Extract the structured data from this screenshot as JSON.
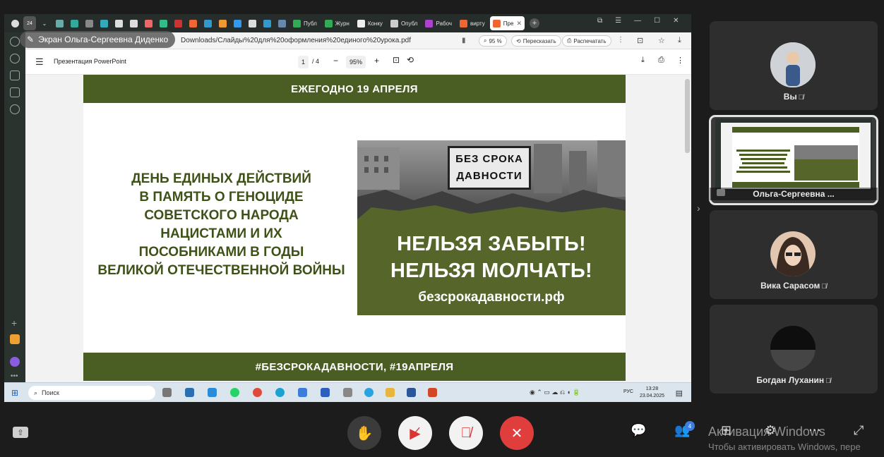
{
  "presenter_label": "Экран Ольга-Сергеевна Диденко",
  "browser": {
    "tabs": [
      {
        "label": "",
        "color": "#6aa"
      },
      {
        "label": "",
        "color": "#3a9"
      },
      {
        "label": "",
        "color": "#888"
      },
      {
        "label": "",
        "color": "#3ab"
      },
      {
        "label": "",
        "color": "#ddd"
      },
      {
        "label": "",
        "color": "#ddd"
      },
      {
        "label": "",
        "color": "#e66"
      },
      {
        "label": "",
        "color": "#3b8"
      },
      {
        "label": "",
        "color": "#c33"
      },
      {
        "label": "",
        "color": "#e63"
      },
      {
        "label": "",
        "color": "#39c"
      },
      {
        "label": "",
        "color": "#e93"
      },
      {
        "label": "",
        "color": "#39e"
      },
      {
        "label": "",
        "color": "#ddd"
      },
      {
        "label": "",
        "color": "#39c"
      },
      {
        "label": "",
        "color": "#68a"
      },
      {
        "label": "Публ",
        "color": "#3a5"
      },
      {
        "label": "Журн",
        "color": "#3a5"
      },
      {
        "label": "Конку",
        "color": "#eee"
      },
      {
        "label": "Опубл",
        "color": "#ccc"
      },
      {
        "label": "Рабоч",
        "color": "#a4c"
      },
      {
        "label": "вирту",
        "color": "#e63"
      }
    ],
    "active_tab": "Пре",
    "url": "Downloads/Слайды%20для%20оформления%20единого%20урока.pdf",
    "zoom_pill": "95 %",
    "retell": "Пересказать",
    "print": "Распечатать"
  },
  "pdf": {
    "title": "Презентация PowerPoint",
    "page": "1",
    "pages": "/ 4",
    "zoom": "95%"
  },
  "slide": {
    "top_band": "ЕЖЕГОДНО 19 АПРЕЛЯ",
    "left_lines": [
      "ДЕНЬ ЕДИНЫХ ДЕЙСТВИЙ",
      "В ПАМЯТЬ О ГЕНОЦИДЕ",
      "СОВЕТСКОГО НАРОДА",
      "НАЦИСТАМИ И ИХ",
      "ПОСОБНИКАМИ В ГОДЫ",
      "ВЕЛИКОЙ ОТЕЧЕСТВЕННОЙ ВОЙНЫ"
    ],
    "stamp_lines": [
      "БЕЗ СРОКА",
      "ДАВНОСТИ"
    ],
    "slogan_lines": [
      "НЕЛЬЗЯ ЗАБЫТЬ!",
      "НЕЛЬЗЯ МОЛЧАТЬ!"
    ],
    "site": "безсрокадавности.рф",
    "bottom_band": "#БЕЗСРОКАДАВНОСТИ, #19АПРЕЛЯ"
  },
  "taskbar": {
    "search": "Поиск",
    "lang": "РУС",
    "time": "13:28",
    "date": "23.04.2025"
  },
  "participants": [
    {
      "name": "Вы",
      "mic_off": true
    },
    {
      "name": "Ольга-Сергеевна ...",
      "mic_off": false,
      "active": true
    },
    {
      "name": "Вика Сарасом",
      "mic_off": true
    },
    {
      "name": "Богдан Луханин",
      "mic_off": true
    }
  ],
  "participants_count": "4",
  "watermark": {
    "line1": "Активация Windows",
    "line2": "Чтобы активировать Windows, пере"
  },
  "colors": {
    "slide_green": "#4a5d23",
    "end_call": "#e03d3d"
  }
}
